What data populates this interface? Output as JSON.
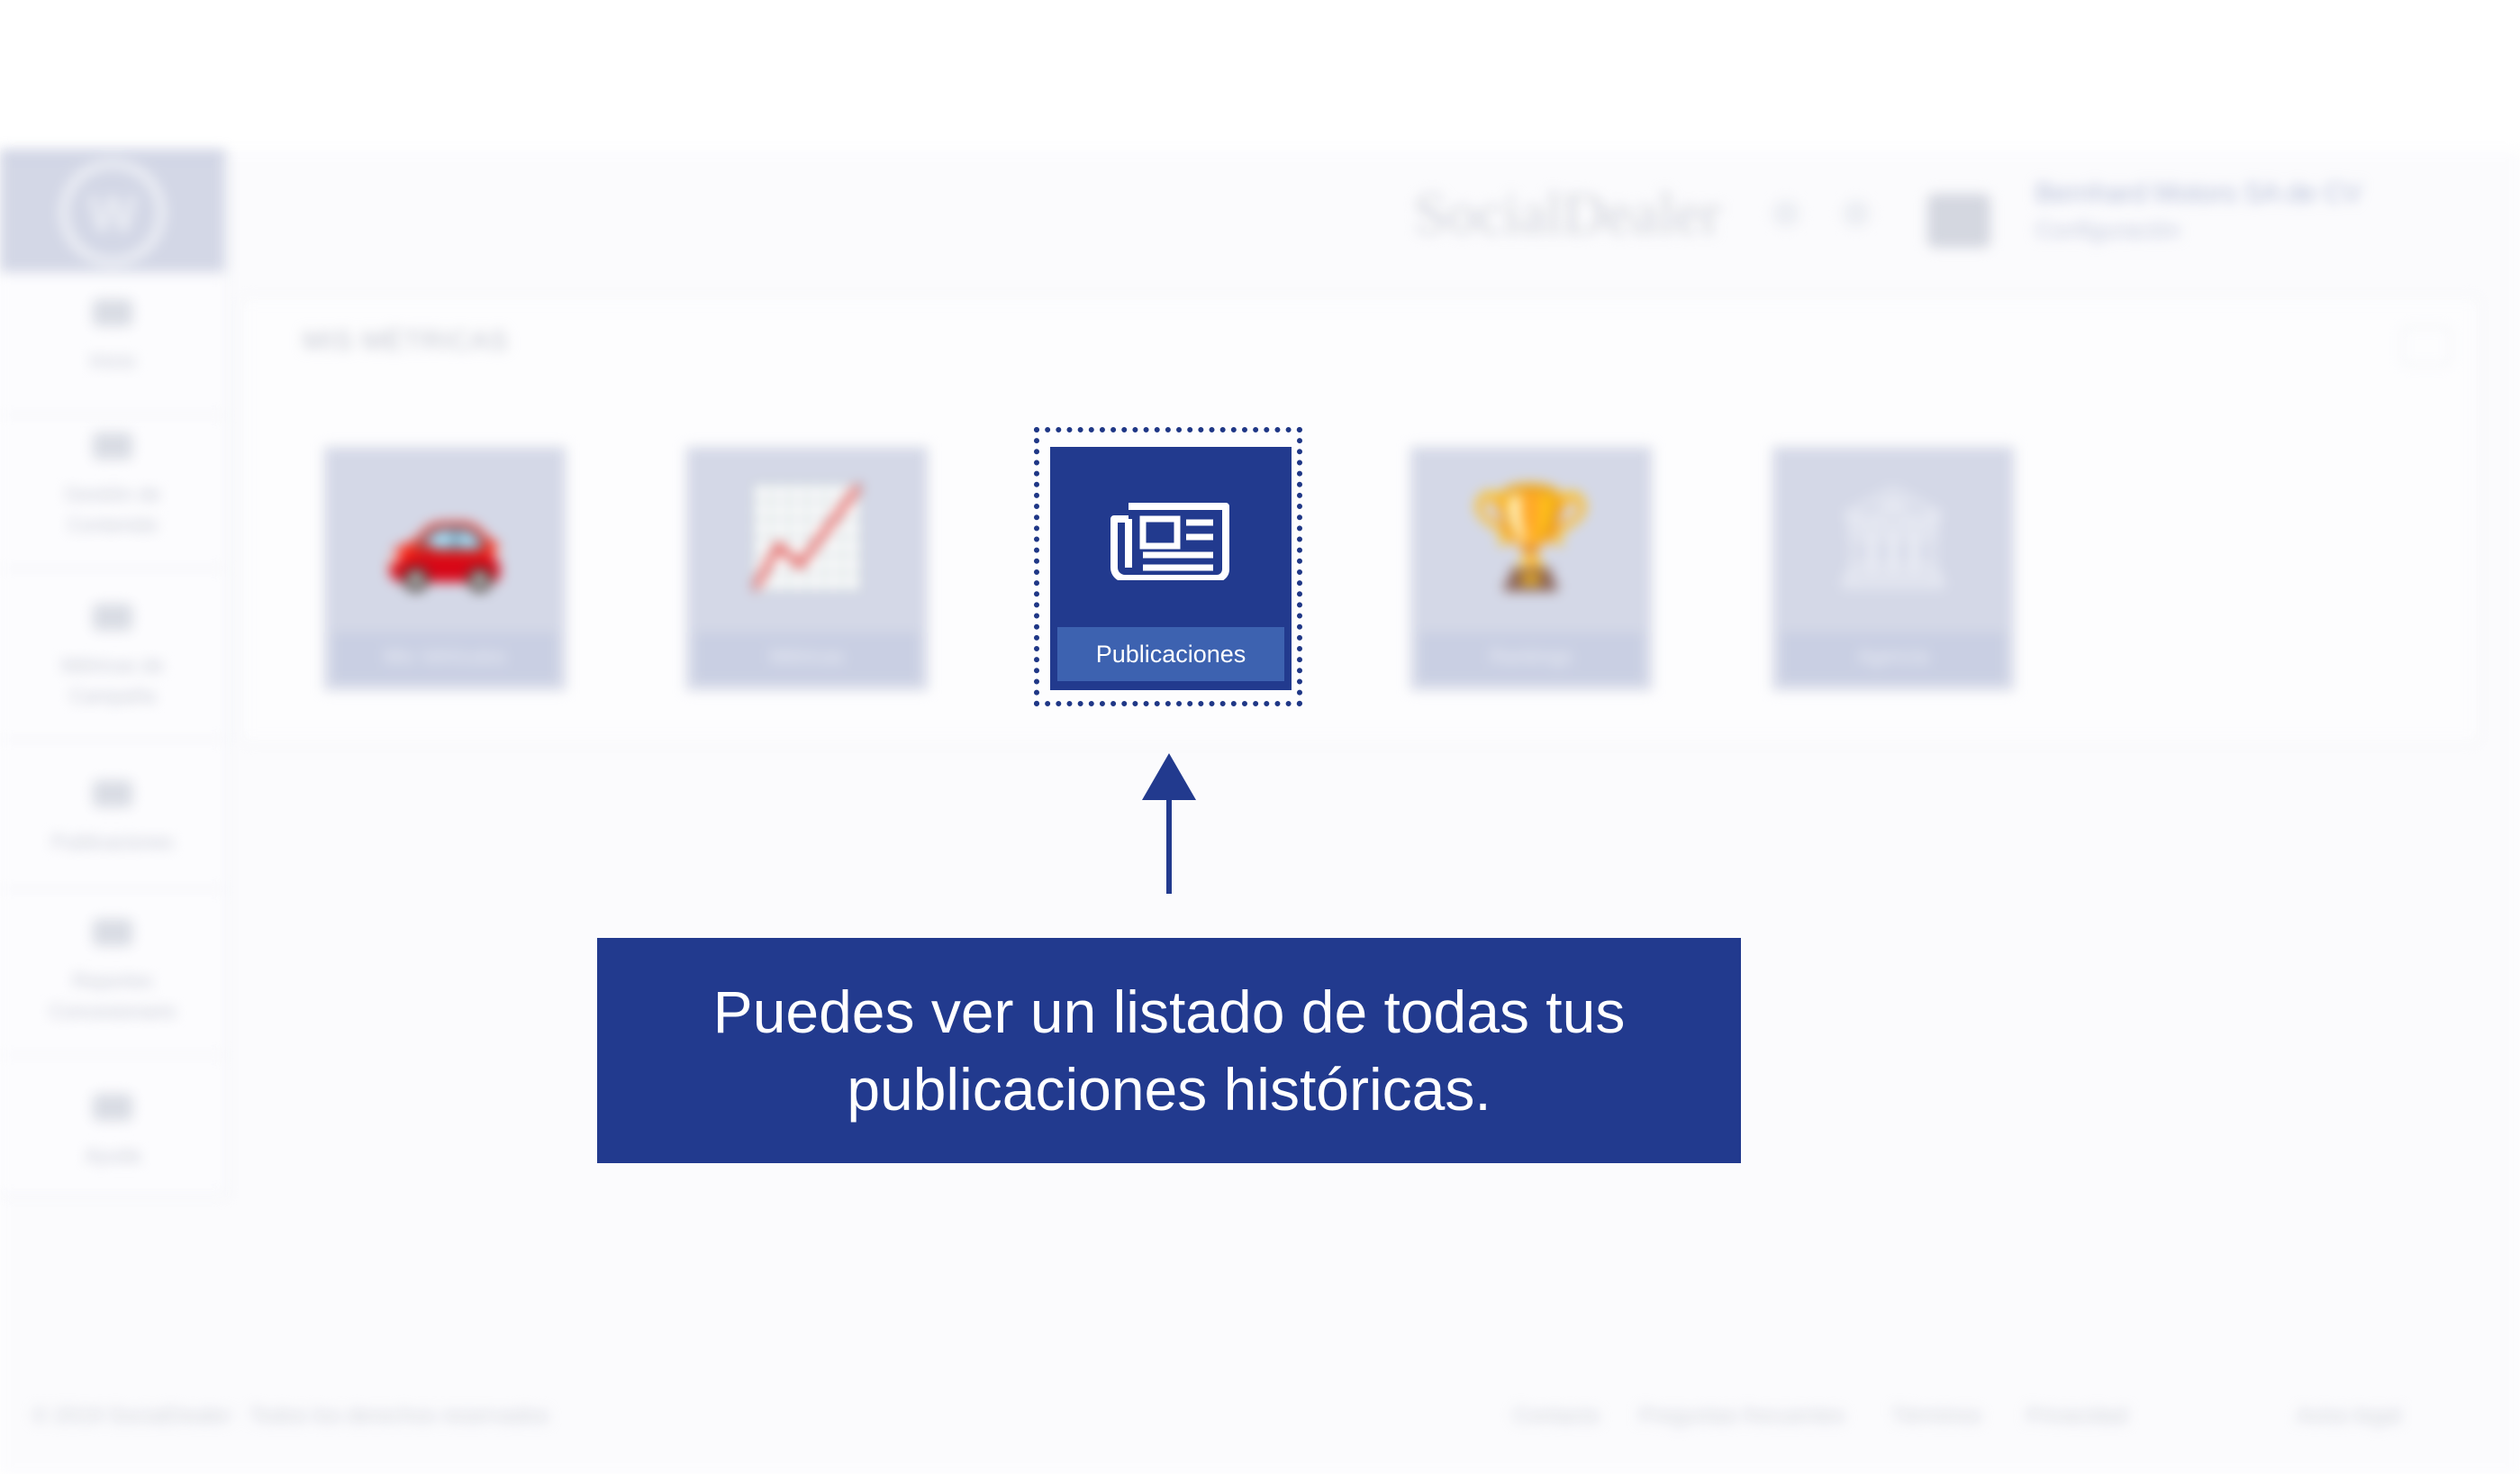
{
  "app": {
    "brand": "SocialDealer",
    "logo_text": "W"
  },
  "header": {
    "user_name": "Bernhard Motors SA de CV",
    "user_role": "Configuración"
  },
  "sidebar": {
    "items": [
      {
        "label": "Inicio"
      },
      {
        "label": "Gestión de Contenido"
      },
      {
        "label": "Métricas de Campaña"
      },
      {
        "label": "Publicaciones"
      },
      {
        "label": "Reportes Concesionario"
      },
      {
        "label": "Ayuda"
      }
    ]
  },
  "main": {
    "section_title": "MIS MÉTRICAS",
    "tiles": [
      {
        "label": "Mis Vehículos",
        "icon": "car-icon",
        "active": false
      },
      {
        "label": "Métricas",
        "icon": "line-chart-icon",
        "active": false
      },
      {
        "label": "Publicaciones",
        "icon": "newspaper-icon",
        "active": true
      },
      {
        "label": "Rankings",
        "icon": "trophy-icon",
        "active": false
      },
      {
        "label": "Agencia",
        "icon": "bank-icon",
        "active": false
      }
    ]
  },
  "callout": {
    "line1": "Puedes ver un listado de todas tus",
    "line2": "publicaciones históricas."
  },
  "footer": {
    "copyright": "© 2019 SocialDealer · Todos los derechos reservados",
    "links": [
      "Contacto",
      "Preguntas frecuentes",
      "Términos",
      "Privacidad",
      "Aviso legal"
    ]
  },
  "colors": {
    "accent": "#223a8e",
    "accent_light": "#3d62b0",
    "tile_faded": "#d4d8e7"
  }
}
